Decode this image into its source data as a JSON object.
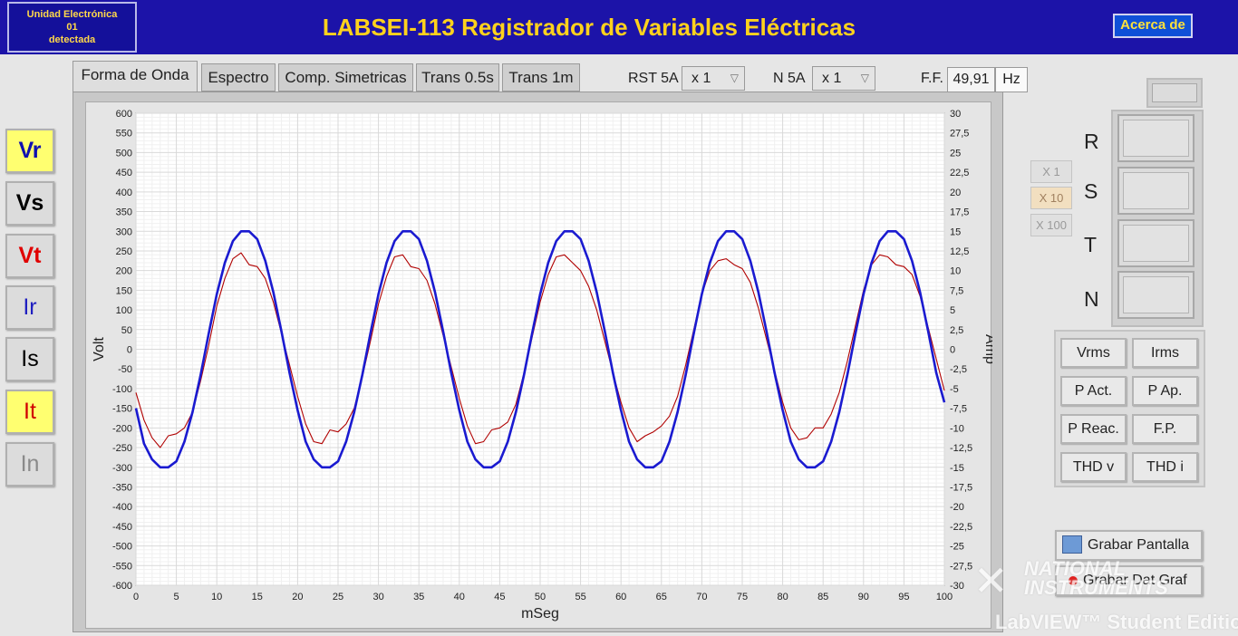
{
  "header": {
    "device_status": [
      "Unidad Electrónica",
      "01",
      "detectada"
    ],
    "title": "LABSEI-113 Registrador de Variables Eléctricas",
    "about_label": "Acerca de"
  },
  "tabs": [
    "Forma de Onda",
    "Espectro",
    "Comp. Simetricas",
    "Trans 0.5s",
    "Trans 1m"
  ],
  "active_tab": "Forma de Onda",
  "controls": {
    "rst_label": "RST 5A",
    "rst_value": "x 1",
    "n_label": "N 5A",
    "n_value": "x 1",
    "ff_label": "F.F.",
    "ff_value": "49,91",
    "ff_unit": "Hz"
  },
  "signals": [
    {
      "label": "Vr",
      "color": "#1010b0",
      "bg": "#ffff70",
      "bold": true
    },
    {
      "label": "Vs",
      "color": "#000000",
      "bg": "#dcdcdc",
      "bold": true
    },
    {
      "label": "Vt",
      "color": "#e00000",
      "bg": "#dcdcdc",
      "bold": true
    },
    {
      "label": "Ir",
      "color": "#2020c0",
      "bg": "#dcdcdc",
      "bold": false
    },
    {
      "label": "Is",
      "color": "#000000",
      "bg": "#dcdcdc",
      "bold": false
    },
    {
      "label": "It",
      "color": "#d00000",
      "bg": "#ffff70",
      "bold": false
    },
    {
      "label": "In",
      "color": "#8a8a8a",
      "bg": "#dcdcdc",
      "bold": false
    }
  ],
  "scale_buttons": [
    "X 1",
    "X 10",
    "X 100"
  ],
  "active_scale": "X 10",
  "phases": [
    "R",
    "S",
    "T",
    "N"
  ],
  "measurements": [
    "Vrms",
    "Irms",
    "P Act.",
    "P Ap.",
    "P Reac.",
    "F.P.",
    "THD v",
    "THD i"
  ],
  "save": {
    "screen_label": "Grabar Pantalla",
    "data_label": "Grabar Dat Graf"
  },
  "watermark": {
    "line1": "NATIONAL",
    "line2": "INSTRUMENTS",
    "line3": "LabVIEW™ Student Edition"
  },
  "chart_data": {
    "type": "line",
    "xlabel": "mSeg",
    "ylabel": "Volt",
    "y2label": "Amp",
    "xlim": [
      0,
      100
    ],
    "ylim": [
      -600,
      600
    ],
    "y2lim": [
      -30,
      30
    ],
    "x_ticks": [
      0,
      5,
      10,
      15,
      20,
      25,
      30,
      35,
      40,
      45,
      50,
      55,
      60,
      65,
      70,
      75,
      80,
      85,
      90,
      95,
      100
    ],
    "y_ticks": [
      600,
      550,
      500,
      450,
      400,
      350,
      300,
      250,
      200,
      150,
      100,
      50,
      0,
      -50,
      -100,
      -150,
      -200,
      -250,
      -300,
      -350,
      -400,
      -450,
      -500,
      -550,
      -600
    ],
    "y2_ticks": [
      "30",
      "27,5",
      "25",
      "22,5",
      "20",
      "17,5",
      "15",
      "12,5",
      "10",
      "7,5",
      "5",
      "2,5",
      "0",
      "-2,5",
      "-5",
      "-7,5",
      "-10",
      "-12,5",
      "-15",
      "-17,5",
      "-20",
      "-22,5",
      "-25",
      "-27,5",
      "-30"
    ],
    "grid": true,
    "series": [
      {
        "axis": "left",
        "color": "#1a1ad0",
        "x": [
          0,
          1,
          2,
          3,
          4,
          5,
          6,
          7,
          8,
          9,
          10,
          11,
          12,
          13,
          14,
          15,
          16,
          17,
          18,
          19,
          20,
          21,
          22,
          23,
          24,
          25,
          26,
          27,
          28,
          29,
          30,
          31,
          32,
          33,
          34,
          35,
          36,
          37,
          38,
          39,
          40,
          41,
          42,
          43,
          44,
          45,
          46,
          47,
          48,
          49,
          50,
          51,
          52,
          53,
          54,
          55,
          56,
          57,
          58,
          59,
          60,
          61,
          62,
          63,
          64,
          65,
          66,
          67,
          68,
          69,
          70,
          71,
          72,
          73,
          74,
          75,
          76,
          77,
          78,
          79,
          80,
          81,
          82,
          83,
          84,
          85,
          86,
          87,
          88,
          89,
          90,
          91,
          92,
          93,
          94,
          95,
          96,
          97,
          98,
          99,
          100
        ],
        "y": [
          -150,
          -240,
          -280,
          -300,
          -300,
          -285,
          -235,
          -160,
          -65,
          40,
          140,
          220,
          275,
          300,
          300,
          280,
          225,
          145,
          45,
          -60,
          -155,
          -235,
          -280,
          -300,
          -300,
          -285,
          -235,
          -160,
          -65,
          40,
          140,
          220,
          275,
          300,
          300,
          280,
          225,
          145,
          45,
          -60,
          -155,
          -235,
          -280,
          -300,
          -300,
          -285,
          -235,
          -160,
          -65,
          40,
          140,
          220,
          275,
          300,
          300,
          280,
          225,
          145,
          45,
          -60,
          -155,
          -235,
          -280,
          -300,
          -300,
          -285,
          -235,
          -160,
          -65,
          40,
          140,
          220,
          275,
          300,
          300,
          280,
          225,
          145,
          45,
          -60,
          -155,
          -235,
          -280,
          -300,
          -300,
          -285,
          -235,
          -160,
          -65,
          40,
          140,
          220,
          275,
          300,
          300,
          280,
          225,
          145,
          45,
          -60,
          -135
        ]
      },
      {
        "axis": "left",
        "color": "#b00000",
        "x": [
          0,
          1,
          2,
          3,
          4,
          5,
          6,
          7,
          8,
          9,
          10,
          11,
          12,
          13,
          14,
          15,
          16,
          17,
          18,
          19,
          20,
          21,
          22,
          23,
          24,
          25,
          26,
          27,
          28,
          29,
          30,
          31,
          32,
          33,
          34,
          35,
          36,
          37,
          38,
          39,
          40,
          41,
          42,
          43,
          44,
          45,
          46,
          47,
          48,
          49,
          50,
          51,
          52,
          53,
          54,
          55,
          56,
          57,
          58,
          59,
          60,
          61,
          62,
          63,
          64,
          65,
          66,
          67,
          68,
          69,
          70,
          71,
          72,
          73,
          74,
          75,
          76,
          77,
          78,
          79,
          80,
          81,
          82,
          83,
          84,
          85,
          86,
          87,
          88,
          89,
          90,
          91,
          92,
          93,
          94,
          95,
          96,
          97,
          98,
          99,
          100
        ],
        "y": [
          -110,
          -180,
          -225,
          -250,
          -220,
          -215,
          -200,
          -160,
          -80,
          10,
          110,
          180,
          230,
          245,
          215,
          210,
          180,
          120,
          40,
          -40,
          -120,
          -190,
          -235,
          -240,
          -205,
          -210,
          -190,
          -150,
          -70,
          20,
          115,
          185,
          235,
          240,
          210,
          205,
          175,
          115,
          35,
          -45,
          -125,
          -195,
          -240,
          -235,
          -205,
          -200,
          -185,
          -140,
          -60,
          30,
          120,
          190,
          235,
          240,
          220,
          200,
          160,
          100,
          20,
          -60,
          -135,
          -200,
          -235,
          -220,
          -210,
          -195,
          -170,
          -120,
          -40,
          50,
          140,
          200,
          225,
          230,
          215,
          205,
          170,
          105,
          25,
          -55,
          -135,
          -200,
          -230,
          -225,
          -200,
          -200,
          -165,
          -110,
          -30,
          60,
          150,
          215,
          240,
          235,
          215,
          210,
          190,
          135,
          55,
          -25,
          -105
        ]
      }
    ]
  }
}
